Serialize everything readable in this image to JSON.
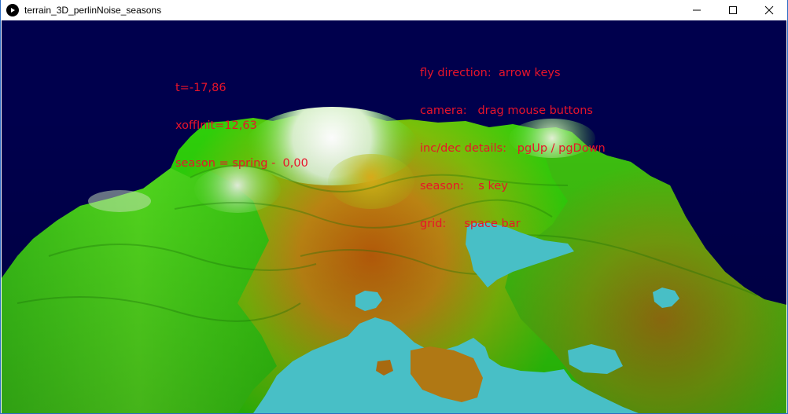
{
  "window": {
    "title": "terrain_3D_perlinNoise_seasons",
    "app_icon": "play-icon",
    "controls": [
      "minimize-icon",
      "maximize-icon",
      "close-icon"
    ]
  },
  "hud": {
    "time": "t=-17,86",
    "xoff": "xoffInit=12,63",
    "season": "season = spring -  0,00"
  },
  "help": [
    {
      "key": "fly direction:",
      "value": "  arrow keys"
    },
    {
      "key": "camera:",
      "value": "   drag mouse buttons"
    },
    {
      "key": "inc/dec details:",
      "value": "   pgUp / pgDown"
    },
    {
      "key": "season:",
      "value": "    s key"
    },
    {
      "key": "grid:",
      "value": "     space bar"
    }
  ],
  "colors": {
    "background": "#00004d",
    "text": "#e8142a",
    "water": "#48bfc6",
    "grass": "#33e010",
    "soil": "#c07a10",
    "snow": "#f2f2f2"
  }
}
